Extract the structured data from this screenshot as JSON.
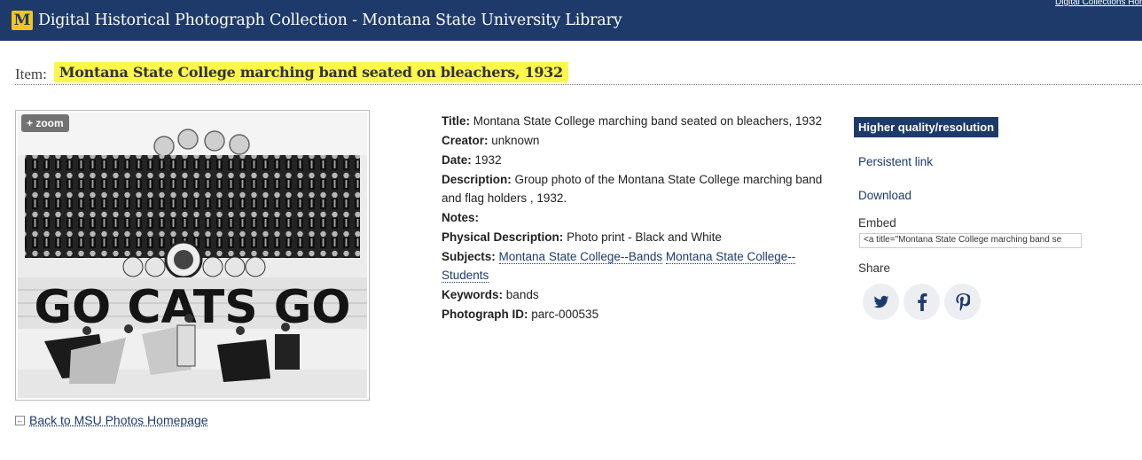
{
  "header": {
    "logo_letter": "M",
    "title": "Digital Historical Photograph Collection - Montana State University Library",
    "top_link": "Digital Collections Home"
  },
  "item": {
    "label": "Item:",
    "title": "Montana State College marching band seated on bleachers, 1932"
  },
  "photo": {
    "zoom_label": "+ zoom",
    "banner_text": "GO CATS GO",
    "alt": "Montana State College marching band seated on bleachers, 1932"
  },
  "back_link": "Back to MSU Photos Homepage",
  "metadata": {
    "title_label": "Title:",
    "title_value": "Montana State College marching band seated on bleachers, 1932",
    "creator_label": "Creator:",
    "creator_value": "unknown",
    "date_label": "Date:",
    "date_value": "1932",
    "description_label": "Description:",
    "description_value": "Group photo of the Montana State College marching band and flag holders , 1932.",
    "notes_label": "Notes:",
    "notes_value": "",
    "physical_label": "Physical Description:",
    "physical_value": "Photo print - Black and White",
    "subjects_label": "Subjects:",
    "subjects": [
      "Montana State College--Bands",
      "Montana State College--Students"
    ],
    "keywords_label": "Keywords:",
    "keywords_value": "bands",
    "photo_id_label": "Photograph ID:",
    "photo_id_value": "parc-000535"
  },
  "side": {
    "hq_button": "Higher quality/resolution",
    "persistent_link": "Persistent link",
    "download": "Download",
    "embed_label": "Embed",
    "embed_value": "<a title=\"Montana State College marching band se",
    "share_label": "Share"
  },
  "share_icons": [
    "twitter-icon",
    "facebook-icon",
    "pinterest-icon"
  ],
  "colors": {
    "header_bg": "#1e3a6b",
    "highlight": "#fbf74b",
    "logo_bg": "#f5c518",
    "link": "#1e3a6b"
  }
}
